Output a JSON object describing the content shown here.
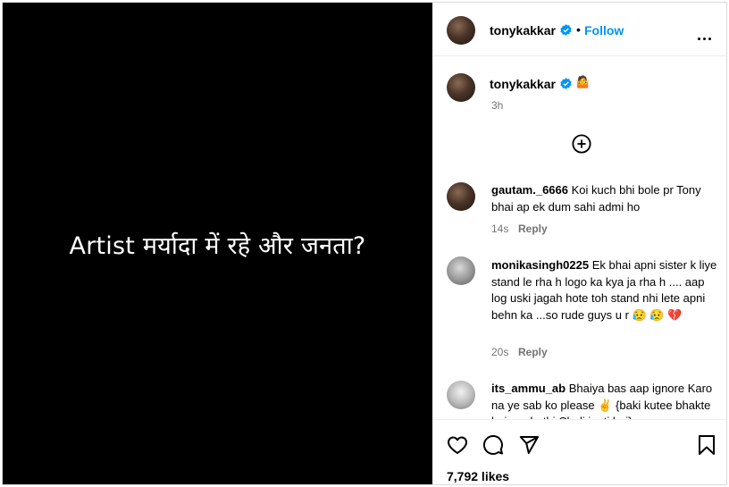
{
  "media": {
    "caption_text": "Artist मर्यादा में रहे और जनता?"
  },
  "header": {
    "username": "tonykakkar",
    "separator": "•",
    "follow_label": "Follow"
  },
  "caption": {
    "username": "tonykakkar",
    "emoji": "🤷",
    "time": "3h"
  },
  "comments": [
    {
      "username": "gautam._6666",
      "text": "Koi kuch bhi bole pr Tony bhai ap ek dum sahi admi ho",
      "time": "14s",
      "reply_label": "Reply"
    },
    {
      "username": "monikasingh0225",
      "text": "Ek bhai apni sister k liye stand le rha h logo ka kya ja rha h .... aap log uski jagah hote toh stand nhi lete apni behn ka ...so rude guys u r 😥 😥 💔",
      "time": "20s",
      "reply_label": "Reply"
    },
    {
      "username": "its_ammu_ab",
      "text": "Bhaiya bas aap ignore Karo na ye sab ko please ✌️ {baki kutee bhakte hai aur hathi Chali jaati hai}",
      "time": "",
      "reply_label": ""
    }
  ],
  "actions": {
    "likes_text": "7,792 likes"
  },
  "colors": {
    "accent": "#0095f6",
    "muted": "#737373",
    "media_bg": "#000000"
  }
}
